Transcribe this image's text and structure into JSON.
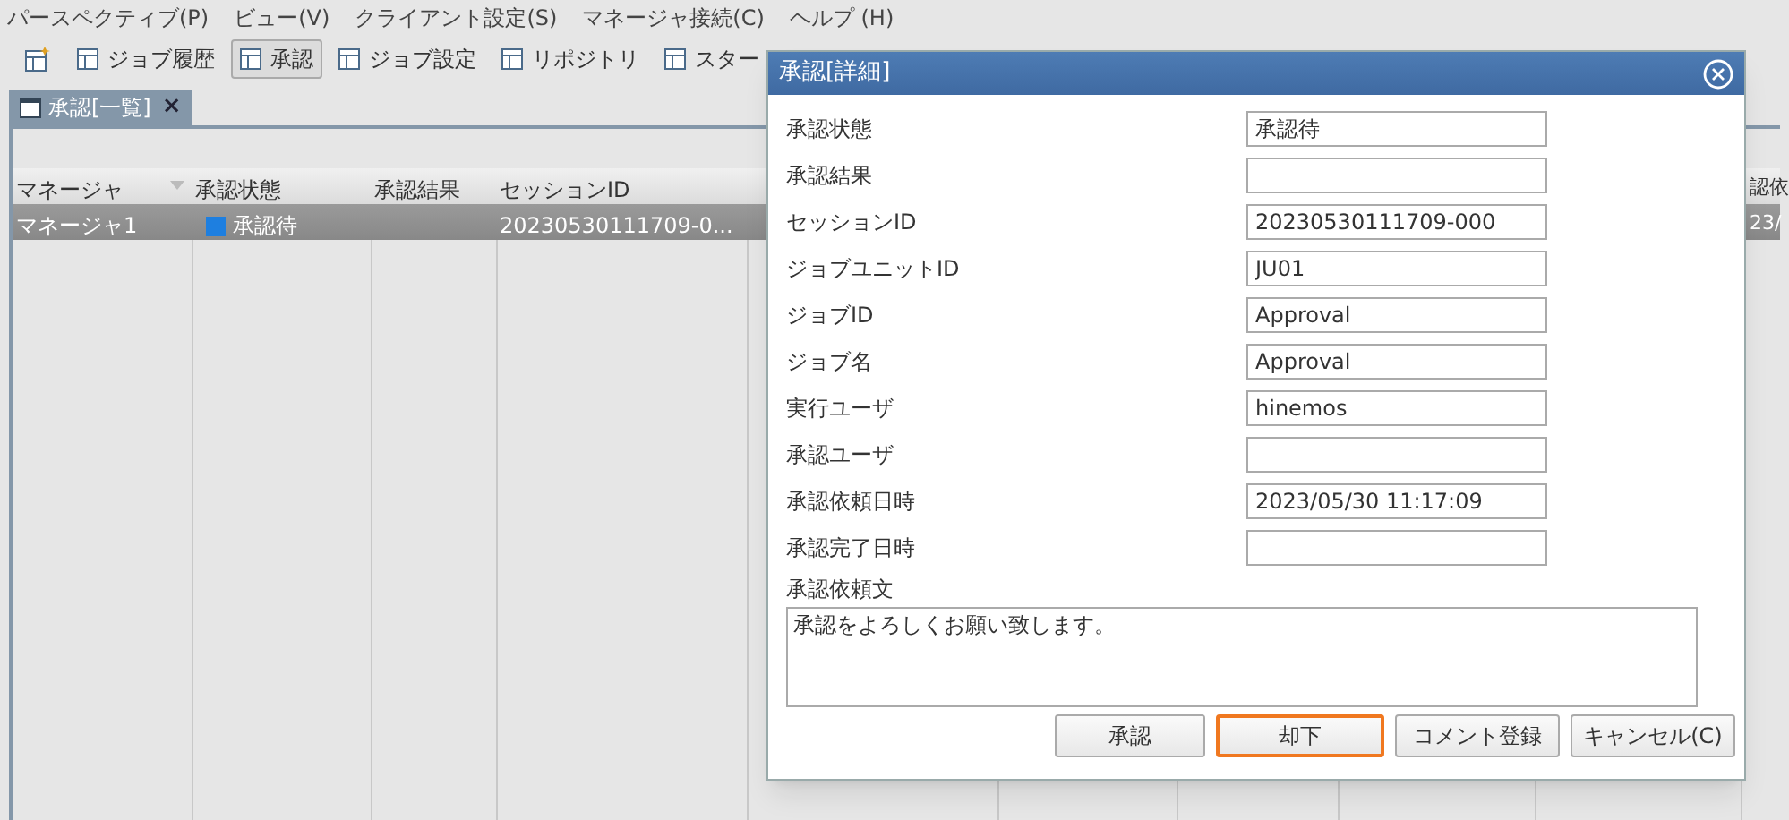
{
  "menu_bar": [
    "パースペクティブ(P)",
    "ビュー(V)",
    "クライアント設定(S)",
    "マネージャ接続(C)",
    "ヘルプ (H)"
  ],
  "toolbar": [
    {
      "label": "ジョブ履歴",
      "selected": false
    },
    {
      "label": "承認",
      "selected": true
    },
    {
      "label": "ジョブ設定",
      "selected": false
    },
    {
      "label": "リポジトリ",
      "selected": false
    },
    {
      "label": "スター",
      "selected": false
    }
  ],
  "view_tab": {
    "label": "承認[一覧]",
    "close": "×"
  },
  "table": {
    "columns": [
      "マネージャ",
      "承認状態",
      "承認結果",
      "セッションID",
      "認依"
    ],
    "rows": [
      {
        "selected": true,
        "manager": "マネージャ1",
        "status": "承認待",
        "session_id": "20230530111709-0...",
        "column_5": "23/",
        "color": "#1e7fe0"
      }
    ]
  },
  "dialog": {
    "title": "承認[詳細]",
    "fields": [
      {
        "label": "承認状態",
        "value": "承認待"
      },
      {
        "label": "承認結果"
      },
      {
        "label": "セッションID",
        "value": "20230530111709-000"
      },
      {
        "label": "ジョブユニットID",
        "value": "JU01"
      },
      {
        "label": "ジョブID",
        "value": "Approval"
      },
      {
        "label": "ジョブ名",
        "value": "Approval"
      },
      {
        "label": "実行ユーザ",
        "value": "hinemos"
      },
      {
        "label": "承認ユーザ"
      },
      {
        "label": "承認依頼日時",
        "value": "2023/05/30 11:17:09"
      },
      {
        "label": "承認完了日時"
      }
    ],
    "message_label": "承認依頼文",
    "message": "承認をよろしくお願い致します。",
    "buttons": [
      {
        "label": "承認",
        "focused": false
      },
      {
        "label": "却下",
        "focused": true
      },
      {
        "label": "コメント登録",
        "focused": false
      },
      {
        "label": "キャンセル(C)",
        "focused": false
      }
    ]
  }
}
